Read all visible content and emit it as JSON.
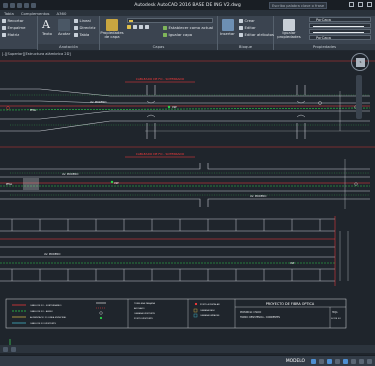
{
  "window": {
    "title": "Autodesk AutoCAD 2016    BASE DE ING V2.dwg",
    "search_placeholder": "Escriba palabra clave o frase"
  },
  "tabs": [
    "Tabla",
    "Complementos",
    "A360"
  ],
  "ribbon": {
    "draw": {
      "items": [
        "Recortar",
        "Empalme",
        "Matriz"
      ],
      "title": ""
    },
    "annotation": {
      "text": "Texto",
      "dim": "Acotar",
      "linear": "Lineal",
      "leader": "Directriz",
      "table": "Tabla",
      "title": "Anotación"
    },
    "layers": {
      "props": "Propiedades de capa",
      "set_current": "Establecer como actual",
      "match": "Igualar capa",
      "title": "Capas"
    },
    "block": {
      "insert": "Insertar",
      "create": "Crear",
      "edit": "Editar",
      "edit_attrs": "Editar atributos",
      "title": "Bloque"
    },
    "properties": {
      "match": "Igualar propiedades",
      "color": "PorCapa",
      "linetype": "PorCapa",
      "lineweight": "PorCapa",
      "title": "Propiedades"
    }
  },
  "canvas": {
    "viewport": "[-][Superior][Estructura alámbrica 2D]",
    "cube_label": "S",
    "sheet": {
      "top_title": "CABLEADO DE FO - SOTERRADO",
      "mid_title": "CABLEADO DE FO - SOTERRADO",
      "street_1": "AV. MORENO",
      "street_2": "AV. MORENO",
      "street_3": "AV. MORENO",
      "labels": [
        "PFIGL",
        "CSP",
        "CSP",
        "PFIGL",
        "CSP"
      ],
      "legend": [
        "CABLE DE FO - SUBTERRANEO",
        "CABLE DE FO - AEREO",
        "ALIMENTACIO FO LINEA MUNICIPAL",
        "CABLE DE FO EXISTENTE",
        "TUNELERA ZANJADA",
        "ADOSADO",
        "CAMARA EXISTENTE",
        "POSTE EXISTENTE",
        "POSTE A INSTALAR",
        "CAMARA PASO",
        "CAMARA EMPALME"
      ],
      "project_title": "PROYECTO DE FIBRA OPTICA",
      "province": "PROVINCIA: CHACO",
      "section": "TRAMO: RESISTENCIA - CORRIENTES",
      "sheet_no": "HOJA",
      "sheet_val": "02 DE 03"
    }
  },
  "status": {
    "mode": "MODELO"
  }
}
